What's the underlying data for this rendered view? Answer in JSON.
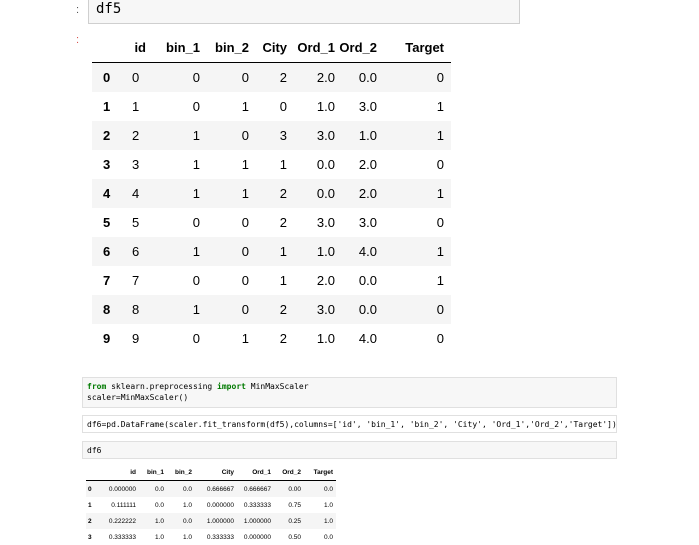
{
  "cell_df5": {
    "code": "df5"
  },
  "df5": {
    "columns": [
      "",
      "id",
      "bin_1",
      "bin_2",
      "City",
      "Ord_1",
      "Ord_2",
      "Target"
    ],
    "rows": [
      [
        "0",
        "0",
        "0",
        "0",
        "2",
        "2.0",
        "0.0",
        "0"
      ],
      [
        "1",
        "1",
        "0",
        "1",
        "0",
        "1.0",
        "3.0",
        "1"
      ],
      [
        "2",
        "2",
        "1",
        "0",
        "3",
        "3.0",
        "1.0",
        "1"
      ],
      [
        "3",
        "3",
        "1",
        "1",
        "1",
        "0.0",
        "2.0",
        "0"
      ],
      [
        "4",
        "4",
        "1",
        "1",
        "2",
        "0.0",
        "2.0",
        "1"
      ],
      [
        "5",
        "5",
        "0",
        "0",
        "2",
        "3.0",
        "3.0",
        "0"
      ],
      [
        "6",
        "6",
        "1",
        "0",
        "1",
        "1.0",
        "4.0",
        "1"
      ],
      [
        "7",
        "7",
        "0",
        "0",
        "1",
        "2.0",
        "0.0",
        "1"
      ],
      [
        "8",
        "8",
        "1",
        "0",
        "2",
        "3.0",
        "0.0",
        "0"
      ],
      [
        "9",
        "9",
        "0",
        "1",
        "2",
        "1.0",
        "4.0",
        "0"
      ]
    ]
  },
  "cell_scaler": {
    "line1_kw1": "from",
    "line1_mod": " sklearn.preprocessing ",
    "line1_kw2": "import",
    "line1_name": " MinMaxScaler",
    "line2": "scaler=MinMaxScaler()"
  },
  "cell_df6_create": {
    "code": "df6=pd.DataFrame(scaler.fit_transform(df5),columns=['id', 'bin_1', 'bin_2', 'City', 'Ord_1','Ord_2','Target'])"
  },
  "cell_df6": {
    "code": "df6"
  },
  "df6": {
    "columns": [
      "",
      "id",
      "bin_1",
      "bin_2",
      "City",
      "Ord_1",
      "Ord_2",
      "Target"
    ],
    "rows": [
      [
        "0",
        "0.000000",
        "0.0",
        "0.0",
        "0.666667",
        "0.666667",
        "0.00",
        "0.0"
      ],
      [
        "1",
        "0.111111",
        "0.0",
        "1.0",
        "0.000000",
        "0.333333",
        "0.75",
        "1.0"
      ],
      [
        "2",
        "0.222222",
        "1.0",
        "0.0",
        "1.000000",
        "1.000000",
        "0.25",
        "1.0"
      ],
      [
        "3",
        "0.333333",
        "1.0",
        "1.0",
        "0.333333",
        "0.000000",
        "0.50",
        "0.0"
      ]
    ]
  }
}
